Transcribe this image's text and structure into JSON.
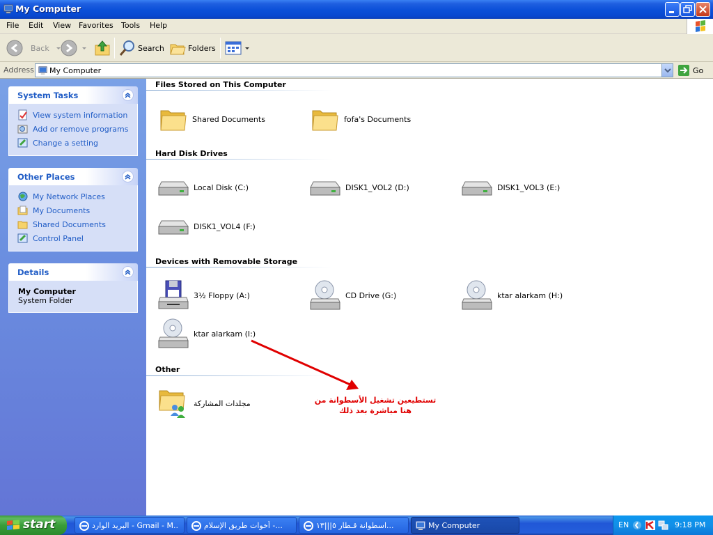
{
  "window": {
    "title": "My Computer"
  },
  "menu": [
    "File",
    "Edit",
    "View",
    "Favorites",
    "Tools",
    "Help"
  ],
  "toolbar": {
    "back": "Back",
    "search": "Search",
    "folders": "Folders"
  },
  "address": {
    "label": "Address",
    "value": "My Computer",
    "go": "Go"
  },
  "sidebar": {
    "system_tasks": {
      "title": "System Tasks",
      "items": [
        "View system information",
        "Add or remove programs",
        "Change a setting"
      ]
    },
    "other_places": {
      "title": "Other Places",
      "items": [
        "My Network Places",
        "My Documents",
        "Shared Documents",
        "Control Panel"
      ]
    },
    "details": {
      "title": "Details",
      "name": "My Computer",
      "type": "System Folder"
    }
  },
  "groups": {
    "files": {
      "title": "Files Stored on This Computer",
      "items": [
        "Shared Documents",
        "fofa's Documents"
      ]
    },
    "hdd": {
      "title": "Hard Disk Drives",
      "items": [
        "Local Disk (C:)",
        "DISK1_VOL2 (D:)",
        "DISK1_VOL3 (E:)",
        "DISK1_VOL4 (F:)"
      ]
    },
    "removable": {
      "title": "Devices with Removable Storage",
      "items": [
        "3½ Floppy (A:)",
        "CD Drive (G:)",
        "ktar alarkam (H:)",
        "ktar alarkam (I:)"
      ]
    },
    "other": {
      "title": "Other",
      "items": [
        "مجلدات المشاركة"
      ]
    }
  },
  "annotation": {
    "text": "تستطيعين تشغيل الأسطوانة من هنا مباشرة بعد ذلك",
    "color": "#e00000"
  },
  "taskbar": {
    "start": "start",
    "tasks": [
      "البريد الوارد - Gmail - M...",
      "أخوات طريق الإسلام -...",
      "اسطوانة قـطار ٥|||١٣...",
      "My Computer"
    ],
    "language": "EN",
    "clock": "9:18 PM"
  }
}
